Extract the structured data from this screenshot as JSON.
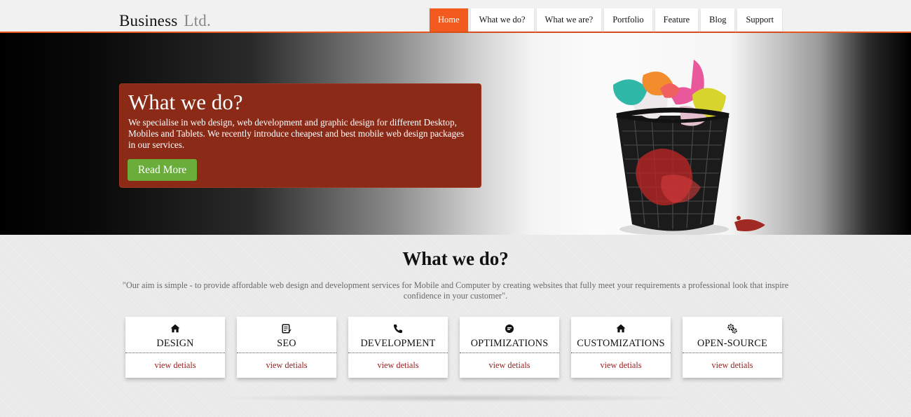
{
  "header": {
    "logo_main": "Business",
    "logo_sub": "Ltd.",
    "nav": [
      "Home",
      "What we do?",
      "What we are?",
      "Portfolio",
      "Feature",
      "Blog",
      "Support"
    ]
  },
  "hero": {
    "title": "What we do?",
    "text": "We specialise in web design, web development and graphic design for different Desktop, Mobiles and Tablets. We recently introduce cheapest and best mobile web design packages in our services.",
    "button_label": "Read More"
  },
  "section": {
    "title": "What we do?",
    "quote": "\"Our aim is simple - to provide affordable web design and development services for Mobile and Computer by creating websites that fully meet your requirements a professional look that inspire confidence in your customer\".",
    "cards": [
      {
        "title": "DESIGN",
        "icon": "home-icon",
        "link": "view detials"
      },
      {
        "title": "SEO",
        "icon": "document-edit-icon",
        "link": "view detials"
      },
      {
        "title": "DEVELOPMENT",
        "icon": "phone-icon",
        "link": "view detials"
      },
      {
        "title": "OPTIMIZATIONS",
        "icon": "chat-bubble-icon",
        "link": "view detials"
      },
      {
        "title": "CUSTOMIZATIONS",
        "icon": "home-icon",
        "link": "view detials"
      },
      {
        "title": "OPEN-SOURCE",
        "icon": "gears-icon",
        "link": "view detials"
      }
    ]
  },
  "colors": {
    "accent": "#f25a1e",
    "hero_box": "#8a2a17",
    "button_green": "#6aad3a",
    "link_red": "#9a2020"
  }
}
